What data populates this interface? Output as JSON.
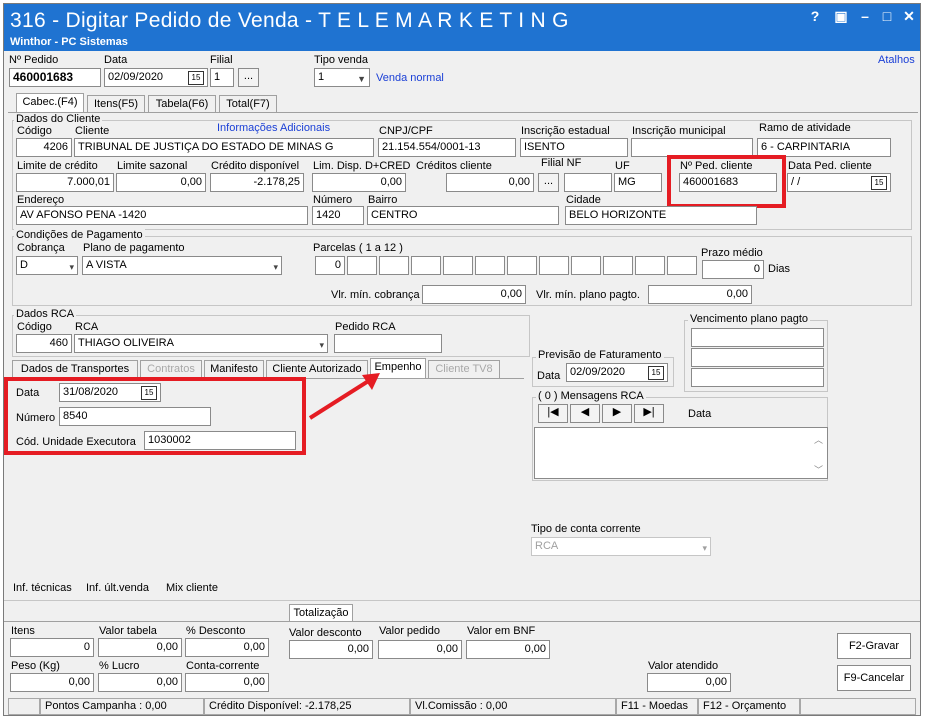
{
  "window": {
    "title": "316 - Digitar Pedido de Venda - T E L E M A R K E T I N G",
    "subtitle": "Winthor - PC Sistemas",
    "controls": [
      "?",
      "▣",
      "–",
      "□",
      "✕"
    ]
  },
  "header": {
    "pedido_label": "Nº Pedido",
    "pedido_value": "460001683",
    "data_label": "Data",
    "data_value": "02/09/2020",
    "filial_label": "Filial",
    "filial_value": "1",
    "tipo_venda_label": "Tipo venda",
    "tipo_venda_value": "1",
    "tipo_venda_text": "Venda normal",
    "atalhos": "Atalhos",
    "ellipsis": "..."
  },
  "main_tabs": [
    "Cabec.(F4)",
    "Itens(F5)",
    "Tabela(F6)",
    "Total(F7)"
  ],
  "cliente": {
    "group_title": "Dados do Cliente",
    "codigo_label": "Código",
    "codigo_value": "4206",
    "cliente_label": "Cliente",
    "cliente_value": "TRIBUNAL DE JUSTIÇA DO ESTADO DE MINAS G",
    "info_adicionais": "Informações Adicionais",
    "cnpj_label": "CNPJ/CPF",
    "cnpj_value": "21.154.554/0001-13",
    "insc_est_label": "Inscrição estadual",
    "insc_est_value": "ISENTO",
    "insc_mun_label": "Inscrição municipal",
    "insc_mun_value": "",
    "ramo_label": "Ramo de atividade",
    "ramo_value": "6 - CARPINTARIA",
    "limite_label": "Limite de crédito",
    "limite_value": "7.000,01",
    "sazonal_label": "Limite sazonal",
    "sazonal_value": "0,00",
    "credito_label": "Crédito disponível",
    "credito_value": "-2.178,25",
    "lim_disp_label": "Lim. Disp. D+CRED",
    "lim_disp_value": "0,00",
    "creditos_label": "Créditos cliente",
    "creditos_value": "0,00",
    "filial_nf_label": "Filial NF",
    "filial_nf_value": "",
    "uf_label": "UF",
    "uf_value": "MG",
    "ped_cliente_label": "Nº Ped. cliente",
    "ped_cliente_value": "460001683",
    "data_ped_label": "Data Ped. cliente",
    "data_ped_value": " / /",
    "endereco_label": "Endereço",
    "endereco_value": "AV AFONSO PENA -1420",
    "numero_label": "Número",
    "numero_value": "1420",
    "bairro_label": "Bairro",
    "bairro_value": "CENTRO",
    "cidade_label": "Cidade",
    "cidade_value": "BELO HORIZONTE"
  },
  "pagamento": {
    "group_title": "Condições de Pagamento",
    "cobranca_label": "Cobrança",
    "cobranca_value": "D",
    "plano_label": "Plano de pagamento",
    "plano_value": "A VISTA",
    "parcelas_label": "Parcelas ( 1 a 12 )",
    "parcelas": [
      "0",
      "",
      "",
      "",
      "",
      "",
      "",
      "",
      "",
      "",
      "",
      ""
    ],
    "prazo_label": "Prazo médio",
    "prazo_value": "0",
    "dias": "Dias",
    "vlr_cobranca_label": "Vlr. mín. cobrança",
    "vlr_cobranca_value": "0,00",
    "vlr_plano_label": "Vlr. mín. plano pagto.",
    "vlr_plano_value": "0,00"
  },
  "rca": {
    "group_title": "Dados RCA",
    "codigo_label": "Código",
    "codigo_value": "460",
    "rca_label": "RCA",
    "rca_value": "THIAGO OLIVEIRA",
    "pedido_rca_label": "Pedido RCA",
    "pedido_rca_value": ""
  },
  "vencimento": {
    "title": "Vencimento plano pagto"
  },
  "sub_tabs": [
    "Dados de Transportes",
    "Contratos",
    "Manifesto",
    "Cliente Autorizado",
    "Empenho",
    "Cliente TV8"
  ],
  "empenho": {
    "data_label": "Data",
    "data_value": "31/08/2020",
    "numero_label": "Número",
    "numero_value": "8540",
    "unidade_label": "Cód. Unidade Executora",
    "unidade_value": "1030002"
  },
  "previsao": {
    "title": "Previsão de Faturamento",
    "data_label": "Data",
    "data_value": "02/09/2020"
  },
  "mensagens": {
    "title": "( 0 ) Mensagens RCA",
    "nav": [
      "|◀",
      "◀",
      "▶",
      "▶|"
    ],
    "data_label": "Data"
  },
  "conta": {
    "label": "Tipo de conta corrente",
    "value": "RCA"
  },
  "inf_links": [
    "Inf. técnicas",
    "Inf. últ.venda",
    "Mix cliente"
  ],
  "totalizacao": {
    "tab": "Totalização",
    "itens_label": "Itens",
    "itens_value": "0",
    "valor_tabela_label": "Valor tabela",
    "valor_tabela_value": "0,00",
    "desconto_label": "% Desconto",
    "desconto_value": "0,00",
    "valor_desconto_label": "Valor desconto",
    "valor_desconto_value": "0,00",
    "valor_pedido_label": "Valor pedido",
    "valor_pedido_value": "0,00",
    "valor_bnf_label": "Valor em BNF",
    "valor_bnf_value": "0,00",
    "peso_label": "Peso (Kg)",
    "peso_value": "0,00",
    "lucro_label": "% Lucro",
    "lucro_value": "0,00",
    "conta_corrente_label": "Conta-corrente",
    "conta_corrente_value": "0,00",
    "valor_atendido_label": "Valor atendido",
    "valor_atendido_value": "0,00",
    "gravar": "F2-Gravar",
    "cancelar": "F9-Cancelar"
  },
  "status_bar": {
    "pontos": "Pontos Campanha : 0,00",
    "credito": "Crédito Disponível: -2.178,25",
    "comissao": "Vl.Comissão : 0,00",
    "moedas": "F11 - Moedas",
    "orcamento": "F12 - Orçamento"
  },
  "colors": {
    "titlebar": "#1f73d1",
    "highlight": "#e51c23",
    "link": "#1a3fd6"
  }
}
